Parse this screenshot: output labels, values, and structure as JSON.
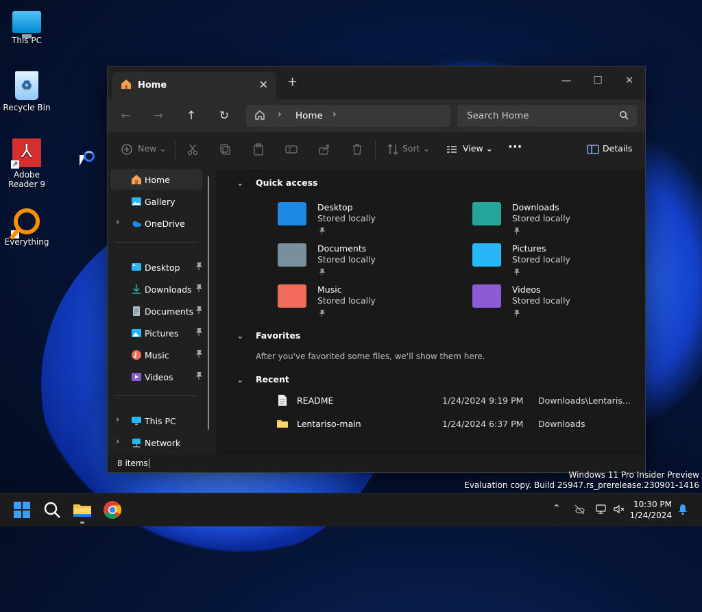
{
  "desktop": {
    "icons": [
      {
        "label": "This PC"
      },
      {
        "label": "Recycle Bin"
      },
      {
        "label": "Adobe Reader 9"
      },
      {
        "label": "Everything"
      }
    ],
    "watermark_line1": "Windows 11 Pro Insider Preview",
    "watermark_line2": "Evaluation copy. Build 25947.rs_prerelease.230901-1416"
  },
  "explorer": {
    "tab_title": "Home",
    "address": {
      "crumb": "Home"
    },
    "search_placeholder": "Search Home",
    "toolbar": {
      "new_label": "New",
      "sort_label": "Sort",
      "view_label": "View",
      "details_label": "Details"
    },
    "sidebar": {
      "top": [
        {
          "label": "Home"
        },
        {
          "label": "Gallery"
        },
        {
          "label": "OneDrive"
        }
      ],
      "pinned": [
        {
          "label": "Desktop"
        },
        {
          "label": "Downloads"
        },
        {
          "label": "Documents"
        },
        {
          "label": "Pictures"
        },
        {
          "label": "Music"
        },
        {
          "label": "Videos"
        }
      ],
      "bottom": [
        {
          "label": "This PC"
        },
        {
          "label": "Network"
        }
      ]
    },
    "quick_access": {
      "title": "Quick access",
      "items": [
        {
          "name": "Desktop",
          "sub": "Stored locally",
          "color": "#1e88e5"
        },
        {
          "name": "Downloads",
          "sub": "Stored locally",
          "color": "#26a69a"
        },
        {
          "name": "Documents",
          "sub": "Stored locally",
          "color": "#78909c"
        },
        {
          "name": "Pictures",
          "sub": "Stored locally",
          "color": "#29b6f6"
        },
        {
          "name": "Music",
          "sub": "Stored locally",
          "color": "#ef6c5a"
        },
        {
          "name": "Videos",
          "sub": "Stored locally",
          "color": "#8e5bd6"
        }
      ]
    },
    "favorites": {
      "title": "Favorites",
      "note": "After you've favorited some files, we'll show them here."
    },
    "recent": {
      "title": "Recent",
      "items": [
        {
          "name": "README",
          "date": "1/24/2024 9:19 PM",
          "location": "Downloads\\Lentaris..."
        },
        {
          "name": "Lentariso-main",
          "date": "1/24/2024 6:37 PM",
          "location": "Downloads"
        }
      ]
    },
    "status": {
      "count": "8 items"
    }
  },
  "taskbar": {
    "time": "10:30 PM",
    "date": "1/24/2024"
  }
}
